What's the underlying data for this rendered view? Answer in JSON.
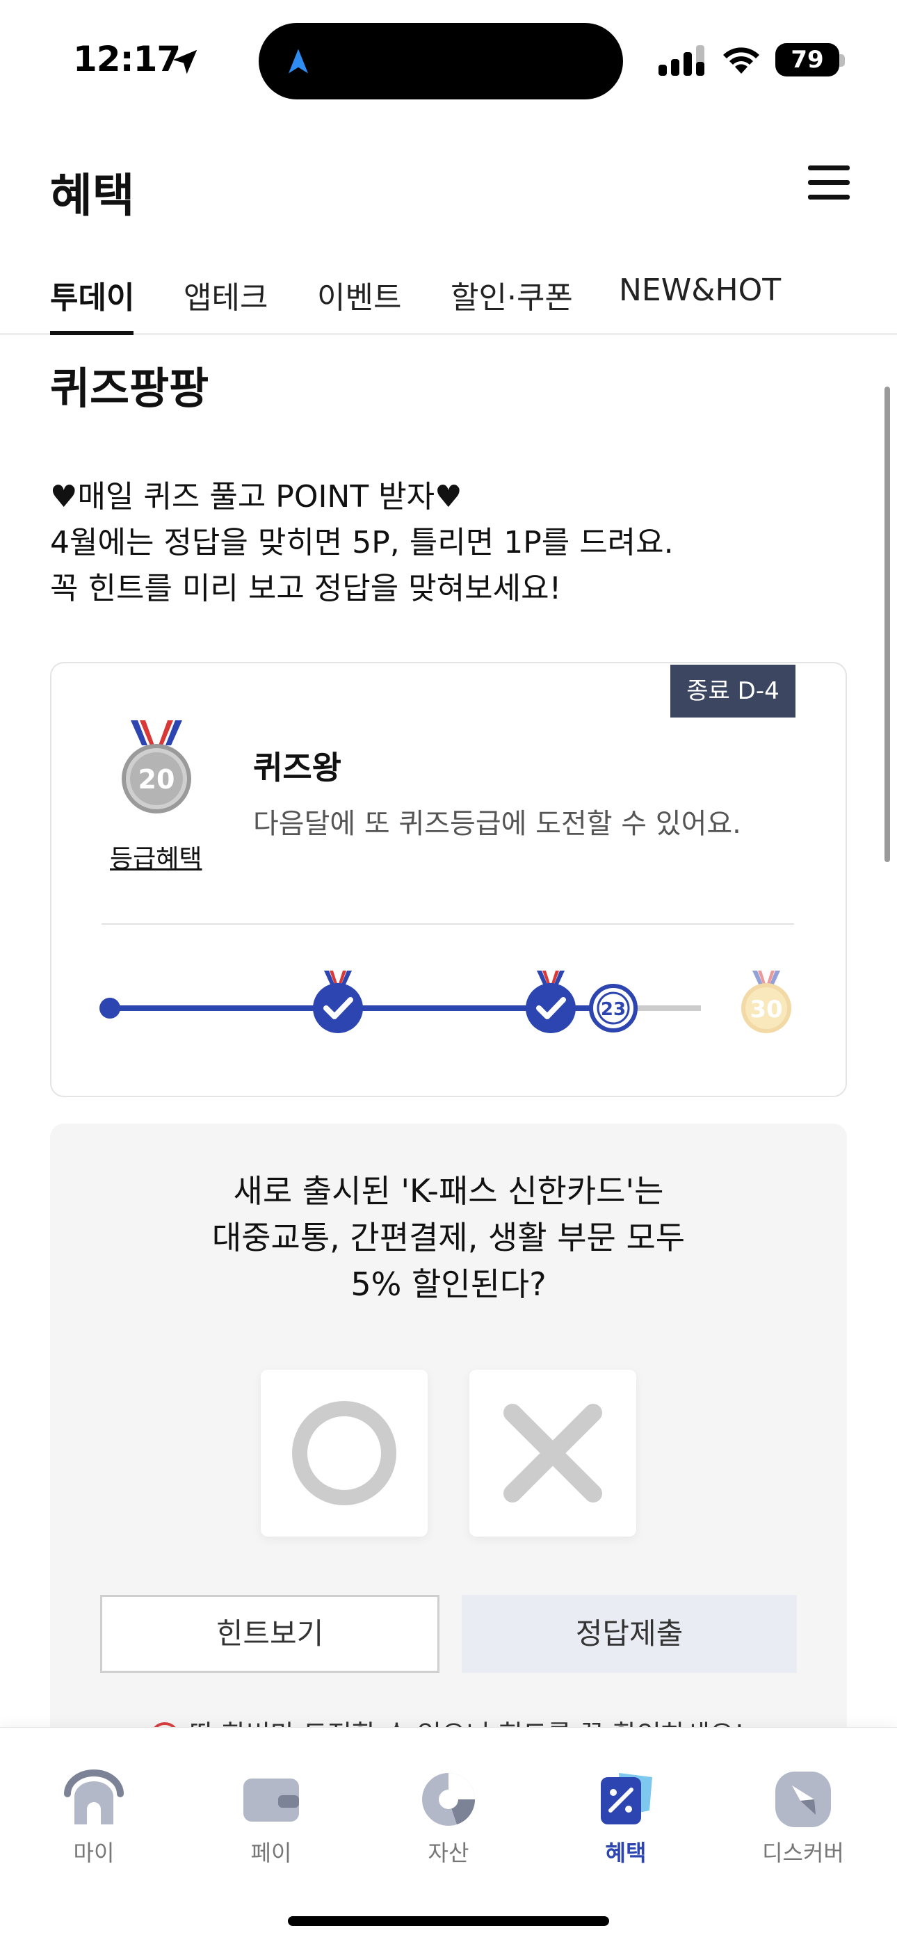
{
  "status_bar": {
    "time": "12:17",
    "battery": "79"
  },
  "header": {
    "title": "혜택"
  },
  "tabs": [
    {
      "label": "투데이",
      "active": true
    },
    {
      "label": "앱테크",
      "active": false
    },
    {
      "label": "이벤트",
      "active": false
    },
    {
      "label": "할인·쿠폰",
      "active": false
    },
    {
      "label": "NEW&HOT",
      "active": false
    }
  ],
  "quiz": {
    "title": "퀴즈팡팡",
    "description": [
      "♥매일 퀴즈 풀고 POINT 받자♥",
      "4월에는 정답을 맞히면 5P, 틀리면 1P를 드려요.",
      "꼭 힌트를 미리 보고 정답을 맞혀보세요!"
    ],
    "grade_card": {
      "dday_badge": "종료 D-4",
      "medal_number": "20",
      "grade_link": "등급혜택",
      "grade_name": "퀴즈왕",
      "grade_sub": "다음달에 또 퀴즈등급에 도전할 수 있어요.",
      "progress": {
        "current": "23",
        "goal": "30",
        "current_fraction": 0.77
      }
    },
    "question": {
      "lines": [
        "새로 출시된 'K-패스 신한카드'는",
        "대중교통, 간편결제, 생활 부문 모두",
        "5% 할인된다?"
      ],
      "hint_button": "힌트보기",
      "submit_button": "정답제출",
      "warning": "딱 한번만 도전할 수 있으니 힌트를 꼭 확인하세요!"
    }
  },
  "bottom_nav": [
    {
      "label": "마이",
      "icon": "home-icon",
      "active": false
    },
    {
      "label": "페이",
      "icon": "wallet-icon",
      "active": false
    },
    {
      "label": "자산",
      "icon": "pie-chart-icon",
      "active": false
    },
    {
      "label": "혜택",
      "icon": "benefit-tag-icon",
      "active": true
    },
    {
      "label": "디스커버",
      "icon": "compass-icon",
      "active": false
    }
  ],
  "colors": {
    "accent": "#2c45b0",
    "badge_bg": "#3c4660",
    "card_bg": "#f5f5f5"
  }
}
